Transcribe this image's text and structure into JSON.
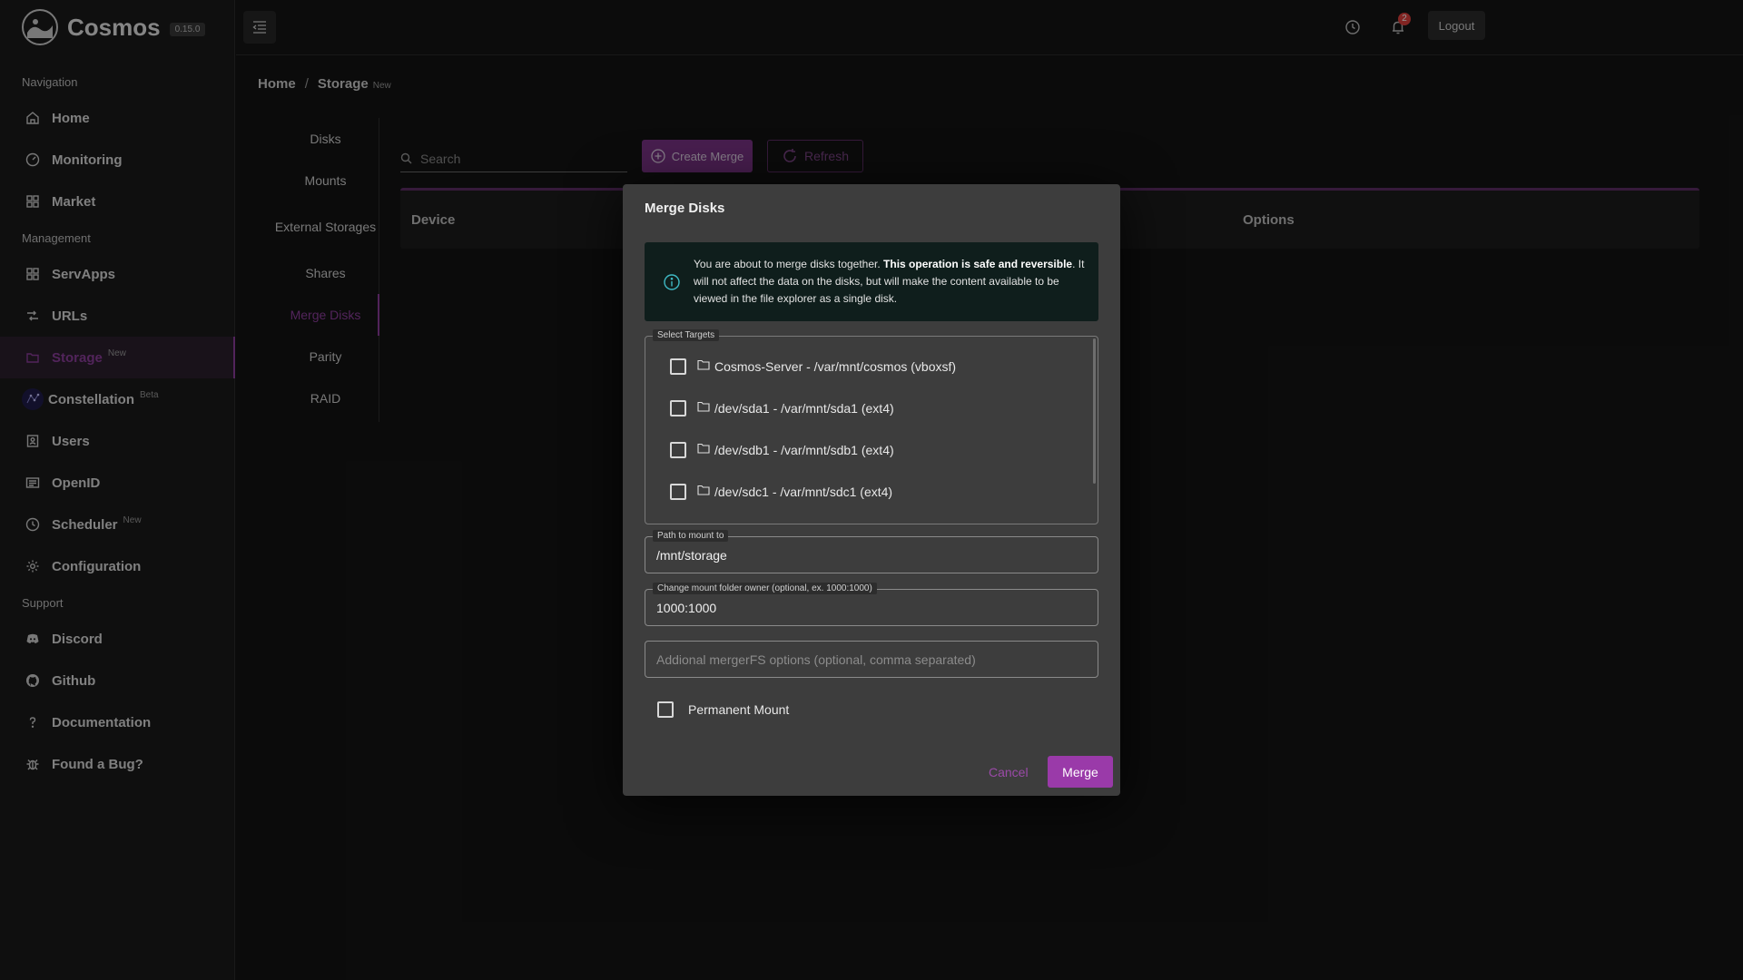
{
  "brand": {
    "name": "Cosmos",
    "version": "0.15.0"
  },
  "sidebar": {
    "sections": [
      "Navigation",
      "Management",
      "Support"
    ],
    "nav": [
      {
        "label": "Home",
        "icon": "home-icon"
      },
      {
        "label": "Monitoring",
        "icon": "dashboard-icon"
      },
      {
        "label": "Market",
        "icon": "apps-icon"
      }
    ],
    "management": [
      {
        "label": "ServApps",
        "icon": "grid-icon"
      },
      {
        "label": "URLs",
        "icon": "route-icon"
      },
      {
        "label": "Storage",
        "icon": "folder-icon",
        "badge": "New",
        "active": true
      },
      {
        "label": "Constellation",
        "icon": "constellation-icon",
        "badge": "Beta"
      },
      {
        "label": "Users",
        "icon": "user-list-icon"
      },
      {
        "label": "OpenID",
        "icon": "id-card-icon"
      },
      {
        "label": "Scheduler",
        "icon": "clock-icon",
        "badge": "New"
      },
      {
        "label": "Configuration",
        "icon": "gear-icon"
      }
    ],
    "support": [
      {
        "label": "Discord",
        "icon": "discord-icon"
      },
      {
        "label": "Github",
        "icon": "github-icon"
      },
      {
        "label": "Documentation",
        "icon": "question-icon"
      },
      {
        "label": "Found a Bug?",
        "icon": "bug-icon"
      }
    ]
  },
  "topbar": {
    "notification_count": "2",
    "logout_label": "Logout"
  },
  "breadcrumb": {
    "home": "Home",
    "sep": "/",
    "current": "Storage",
    "badge": "New"
  },
  "subnav": [
    "Disks",
    "Mounts",
    "External Storages",
    "Shares",
    "Merge Disks",
    "Parity",
    "RAID"
  ],
  "toolbar": {
    "search_placeholder": "Search",
    "create_label": "Create Merge",
    "refresh_label": "Refresh"
  },
  "table": {
    "col_device": "Device",
    "col_options": "Options"
  },
  "dialog": {
    "title": "Merge Disks",
    "alert_pre": "You are about to merge disks together. ",
    "alert_bold": "This operation is safe and reversible",
    "alert_post": ". It will not affect the data on the disks, but will make the content available to be viewed in the file explorer as a single disk.",
    "targets_legend": "Select Targets",
    "targets": [
      "Cosmos-Server - /var/mnt/cosmos (vboxsf)",
      "/dev/sda1 - /var/mnt/sda1 (ext4)",
      "/dev/sdb1 - /var/mnt/sdb1 (ext4)",
      "/dev/sdc1 - /var/mnt/sdc1 (ext4)"
    ],
    "path_label": "Path to mount to",
    "path_value": "/mnt/storage",
    "owner_label": "Change mount folder owner (optional, ex. 1000:1000)",
    "owner_value": "1000:1000",
    "options_placeholder": "Addional mergerFS options (optional, comma separated)",
    "permanent_label": "Permanent Mount",
    "cancel_label": "Cancel",
    "merge_label": "Merge"
  },
  "colors": {
    "accent": "#9a3aa9",
    "sidebar_bg": "#1b1b1b",
    "dialog_bg": "#3d3d3d",
    "alert_bg": "#0f1e1c"
  }
}
